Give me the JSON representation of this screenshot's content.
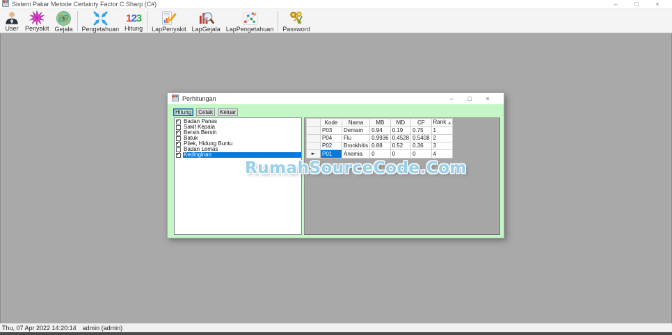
{
  "window": {
    "title": "Sistem Pakar Metode Certainty Factor C Sharp (C#)",
    "minimize": "–",
    "maximize": "□",
    "close": "×"
  },
  "toolbar": {
    "items": [
      {
        "label": "User",
        "icon": "user-icon",
        "separator_after": false
      },
      {
        "label": "Penyakit",
        "icon": "disease-starburst-icon",
        "separator_after": false
      },
      {
        "label": "Gejala",
        "icon": "symptom-atom-icon",
        "separator_after": true
      },
      {
        "label": "Pengetahuan",
        "icon": "knowledge-arrows-icon",
        "separator_after": false
      },
      {
        "label": "Hitung",
        "icon": "numbers-123-icon",
        "separator_after": true
      },
      {
        "label": "LapPenyakit",
        "icon": "report-chart-pencil-icon",
        "separator_after": false
      },
      {
        "label": "LapGejala",
        "icon": "chart-magnifier-icon",
        "separator_after": false
      },
      {
        "label": "LapPengetahuan",
        "icon": "scatter-network-icon",
        "separator_after": true
      },
      {
        "label": "Password",
        "icon": "gold-keys-icon",
        "separator_after": false
      }
    ]
  },
  "dialog": {
    "title": "Perhitungan",
    "minimize": "–",
    "maximize": "□",
    "close": "×",
    "buttons": [
      {
        "label": "Hitung",
        "focused": true
      },
      {
        "label": "Cetak",
        "focused": false
      },
      {
        "label": "Keluar",
        "focused": false
      }
    ],
    "check_glyph": "✓",
    "checklist": [
      {
        "label": "Badan Panas",
        "checked": true,
        "selected": false
      },
      {
        "label": "Sakit Kepala",
        "checked": false,
        "selected": false
      },
      {
        "label": "Bersin Bersin",
        "checked": true,
        "selected": false
      },
      {
        "label": "Batuk",
        "checked": false,
        "selected": false
      },
      {
        "label": "Pilek, Hidung Buntu",
        "checked": true,
        "selected": false
      },
      {
        "label": "Badan Lemas",
        "checked": false,
        "selected": false
      },
      {
        "label": "Kedinginan",
        "checked": true,
        "selected": true
      }
    ],
    "grid": {
      "columns": [
        "Kode",
        "Nama",
        "MB",
        "MD",
        "CF",
        "Rank"
      ],
      "sort_column": "Rank",
      "sort_glyph": "▲",
      "current_row_glyph": "►",
      "rows": [
        {
          "cells": [
            "P03",
            "Demam",
            "0.94",
            "0.19",
            "0.75",
            "1"
          ],
          "current": false
        },
        {
          "cells": [
            "P04",
            "Flu",
            "0.9936",
            "0.4528",
            "0.5408",
            "2"
          ],
          "current": false
        },
        {
          "cells": [
            "P02",
            "Bronkhitis",
            "0.88",
            "0.52",
            "0.36",
            "3"
          ],
          "current": false
        },
        {
          "cells": [
            "P01",
            "Anemia",
            "0",
            "0",
            "0",
            "4"
          ],
          "current": true
        }
      ],
      "selected_cell": {
        "row": 3,
        "col": 0
      }
    }
  },
  "watermark": "RumahSourceCode.Com",
  "statusbar": {
    "datetime": "Thu, 07 Apr 2022 14:20:14",
    "user": "admin (admin)"
  },
  "colors": {
    "client_green": "#c5f6c5",
    "selection_blue": "#0a78d4",
    "desktop_gray": "#a9a9a9"
  }
}
